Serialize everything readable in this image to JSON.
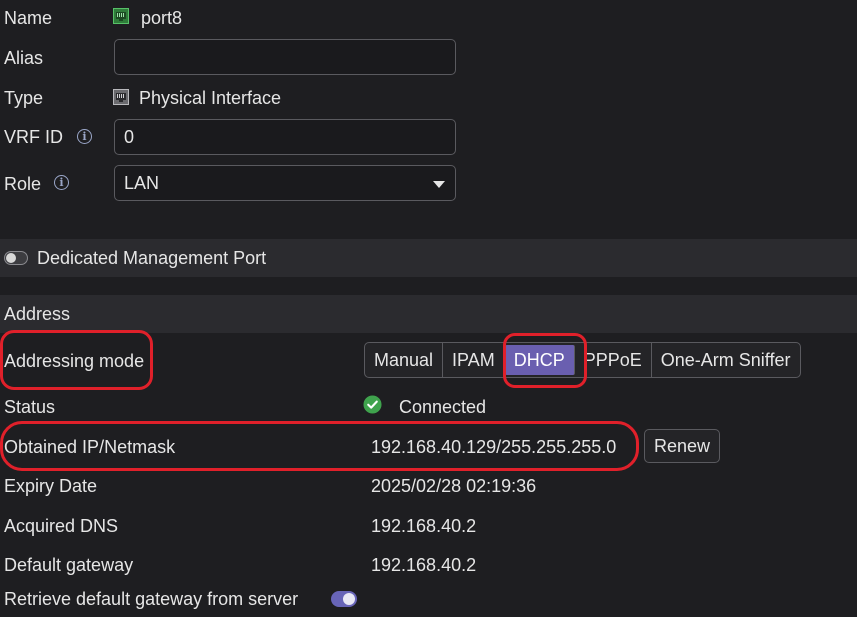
{
  "fields": {
    "name_label": "Name",
    "name_value": "port8",
    "alias_label": "Alias",
    "alias_value": "",
    "type_label": "Type",
    "type_value": "Physical Interface",
    "vrf_label": "VRF ID",
    "vrf_value": "0",
    "role_label": "Role",
    "role_value": "LAN"
  },
  "dedicated": {
    "label": "Dedicated Management Port",
    "enabled": false
  },
  "address": {
    "section_title": "Address",
    "addressing_mode_label": "Addressing mode",
    "modes": [
      "Manual",
      "IPAM",
      "DHCP",
      "PPPoE",
      "One-Arm Sniffer"
    ],
    "selected_mode": "DHCP",
    "status_label": "Status",
    "status_value": "Connected",
    "obtained_label": "Obtained IP/Netmask",
    "obtained_value": "192.168.40.129/255.255.255.0",
    "renew_label": "Renew",
    "expiry_label": "Expiry Date",
    "expiry_value": "2025/02/28 02:19:36",
    "dns_label": "Acquired DNS",
    "dns_value": "192.168.40.2",
    "gateway_label": "Default gateway",
    "gateway_value": "192.168.40.2",
    "retrieve_label": "Retrieve default gateway from server",
    "retrieve_enabled": true
  },
  "colors": {
    "background": "#1e1e21",
    "section_bg": "#2b2b2f",
    "accent": "#6a5fb0",
    "highlight": "#e0202a",
    "status_ok": "#3fa34d",
    "port_icon": "#3aa14a"
  }
}
